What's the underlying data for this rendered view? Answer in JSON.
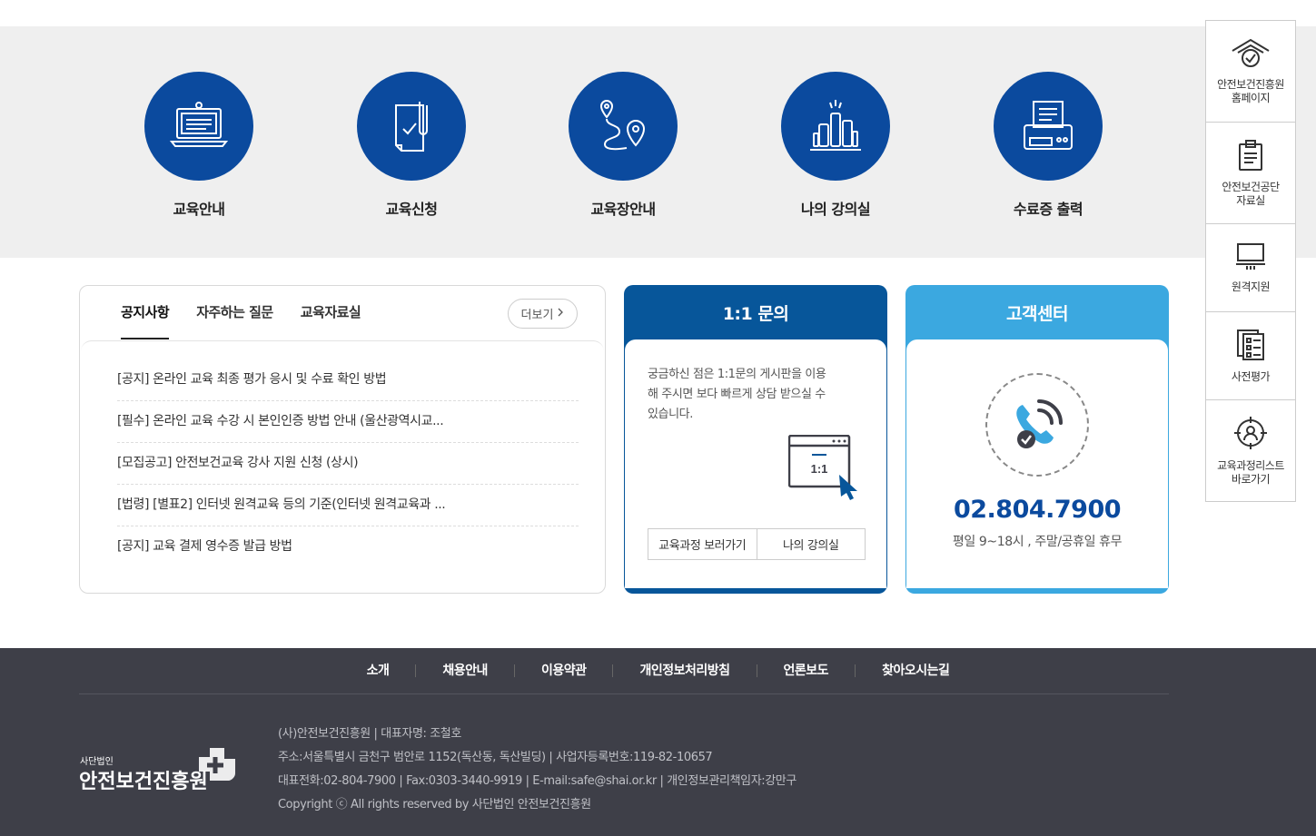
{
  "quick_menu": [
    {
      "label": "교육안내",
      "icon": "laptop-icon"
    },
    {
      "label": "교육신청",
      "icon": "document-check-icon"
    },
    {
      "label": "교육장안내",
      "icon": "map-route-icon"
    },
    {
      "label": "나의 강의실",
      "icon": "bar-chart-icon"
    },
    {
      "label": "수료증 출력",
      "icon": "printer-icon"
    }
  ],
  "notice": {
    "tabs": [
      "공지사항",
      "자주하는 질문",
      "교육자료실"
    ],
    "more_label": "더보기",
    "items": [
      "[공지] 온라인 교육 최종 평가 응시 및 수료 확인 방법",
      "[필수] 온라인 교육 수강 시 본인인증 방법 안내 (울산광역시교...",
      "[모집공고] 안전보건교육 강사 지원 신청 (상시)",
      "[법령] [별표2] 인터넷 원격교육 등의 기준(인터넷 원격교육과 ...",
      "[공지] 교육 결제 영수증 발급 방법"
    ]
  },
  "inquiry": {
    "title": "1:1 문의",
    "description": "궁금하신 점은 1:1문의 게시판을 이용해 주시면 보다 빠르게 상담 받으실 수 있습니다.",
    "illust_text": "1:1",
    "buttons": [
      "교육과정 보러가기",
      "나의 강의실"
    ]
  },
  "customer_center": {
    "title": "고객센터",
    "phone": "02.804.7900",
    "hours": "평일 9~18시 , 주말/공휴일 휴무"
  },
  "side_menu": [
    {
      "label": "안전보건진흥원\n홈페이지",
      "icon": "home-check-icon"
    },
    {
      "label": "안전보건공단\n자료실",
      "icon": "clipboard-icon"
    },
    {
      "label": "원격지원",
      "icon": "monitor-icon"
    },
    {
      "label": "사전평가",
      "icon": "checklist-icon"
    },
    {
      "label": "교육과정리스트\n바로가기",
      "icon": "target-user-icon"
    }
  ],
  "footer": {
    "nav": [
      "소개",
      "채용안내",
      "이용약관",
      "개인정보처리방침",
      "언론보도",
      "찾아오시는길"
    ],
    "logo_small": "사단법인",
    "logo_name": "안전보건진흥원",
    "info": [
      "(사)안전보건진흥원 | 대표자명: 조철호",
      "주소:서울특별시 금천구 범안로 1152(독산동, 독산빌딩) | 사업자등록번호:119-82-10657",
      "대표전화:02-804-7900 | Fax:0303-3440-9919 | E-mail:safe@shai.or.kr | 개인정보관리책임자:강만구",
      "Copyright ⓒ All rights reserved by 사단법인 안전보건진흥원"
    ]
  },
  "colors": {
    "primary_blue": "#0b4a9e",
    "inquiry_blue": "#07569a",
    "cs_blue": "#3ba8e0",
    "footer_bg": "#3e3f48",
    "band_bg": "#efefef"
  }
}
